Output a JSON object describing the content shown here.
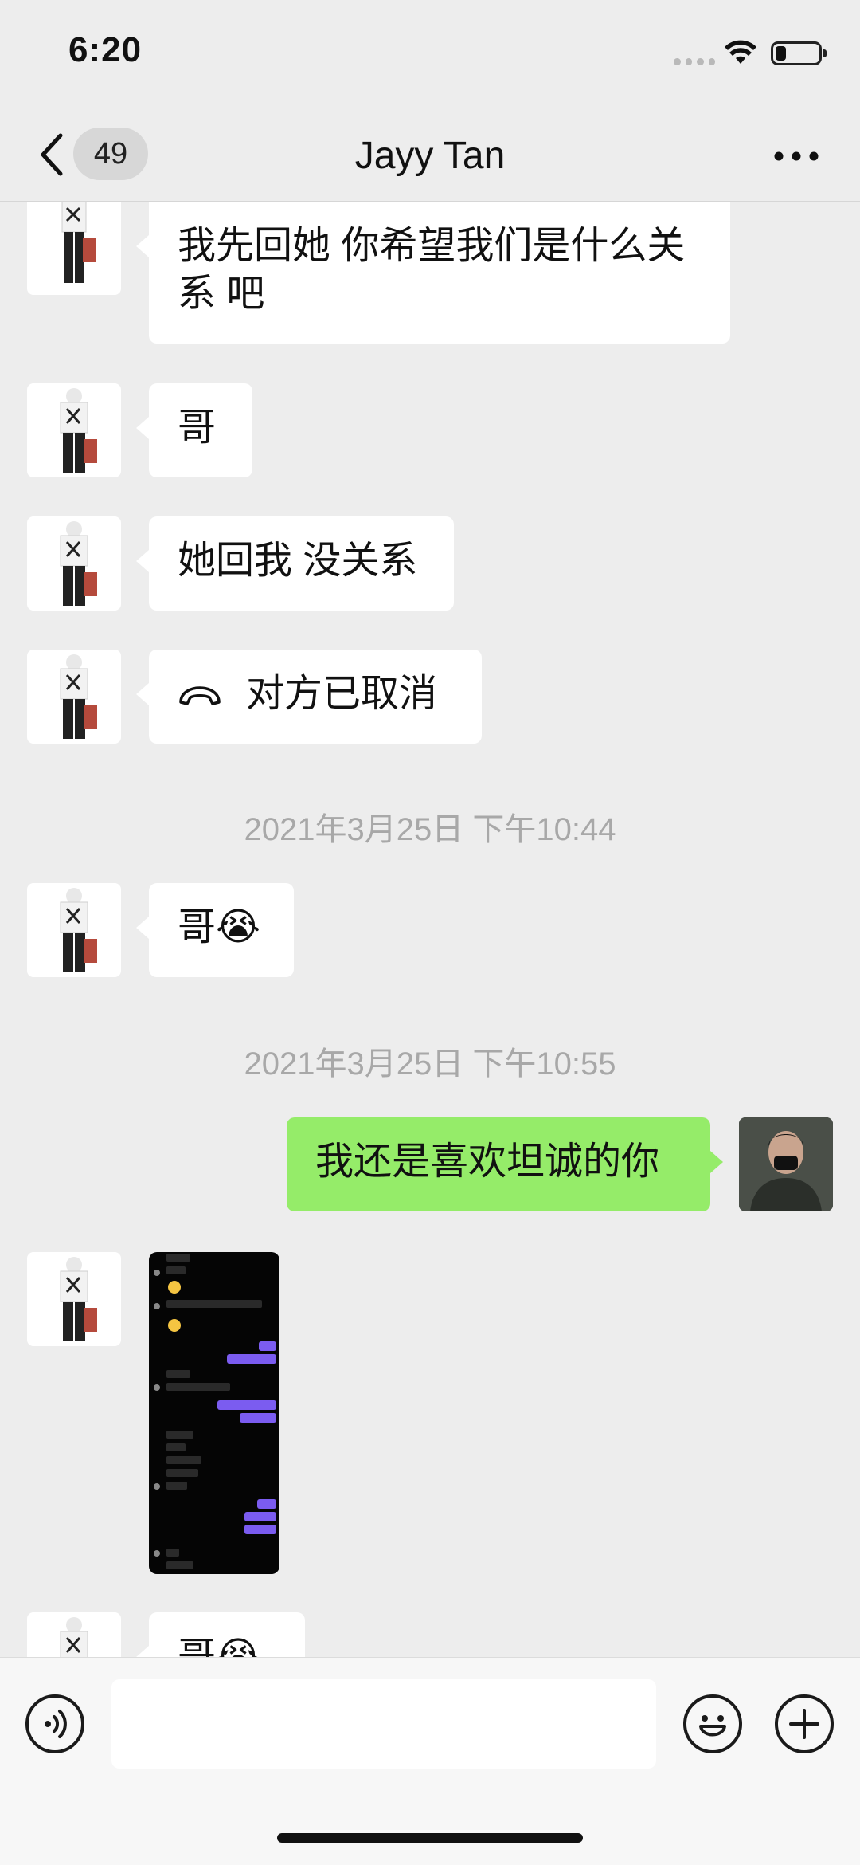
{
  "status": {
    "time": "6:20"
  },
  "nav": {
    "unread_count": "49",
    "title": "Jayy Tan"
  },
  "messages": {
    "m1": "我先回她 你希望我们是什么关系 吧",
    "m2": "哥",
    "m3": "她回我 没关系",
    "m4_call": "对方已取消",
    "ts1": "2021年3月25日 下午10:44",
    "m5": "哥😭",
    "ts2": "2021年3月25日 下午10:55",
    "m6_out": "我还是喜欢坦诚的你",
    "m7_partial": "哥😭"
  },
  "colors": {
    "outgoing_bubble": "#95ec69",
    "incoming_bubble": "#ffffff",
    "background": "#ededed"
  },
  "icons": [
    "chevron-left-icon",
    "more-icon",
    "hangup-icon",
    "voice-icon",
    "emoji-icon",
    "plus-icon"
  ]
}
